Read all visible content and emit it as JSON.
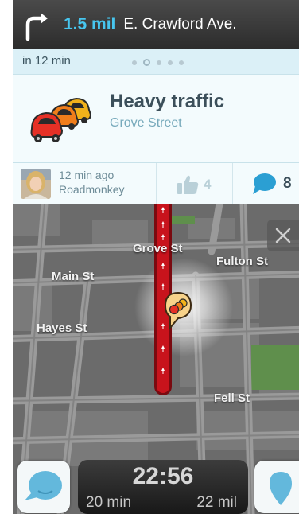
{
  "navigation": {
    "distance": "1.5 mil",
    "street": "E. Crawford Ave.",
    "turn_icon": "turn-right-arrow-icon"
  },
  "alert": {
    "eta_text": "in 12 min",
    "pager": {
      "count": 5,
      "active_index": 1
    },
    "title": "Heavy traffic",
    "subtitle": "Grove Street",
    "icon": "traffic-jam-icon",
    "reported_ago": "12 min ago",
    "reporter": "Roadmonkey",
    "thumbs_count": "4",
    "comments_count": "8"
  },
  "map": {
    "street_labels": {
      "grove": "Grove St",
      "fulton": "Fulton St",
      "main": "Main St",
      "hayes": "Hayes St",
      "fell": "Fell St"
    },
    "route_color": "#c8131c",
    "close_icon": "close-icon"
  },
  "bottom_bar": {
    "clock": "22:56",
    "eta_minutes": "20 min",
    "distance_remaining": "22 mil"
  },
  "colors": {
    "accent_blue": "#47c6ef",
    "route_red": "#c8131c",
    "nav_bar": "#2c2c2c"
  }
}
